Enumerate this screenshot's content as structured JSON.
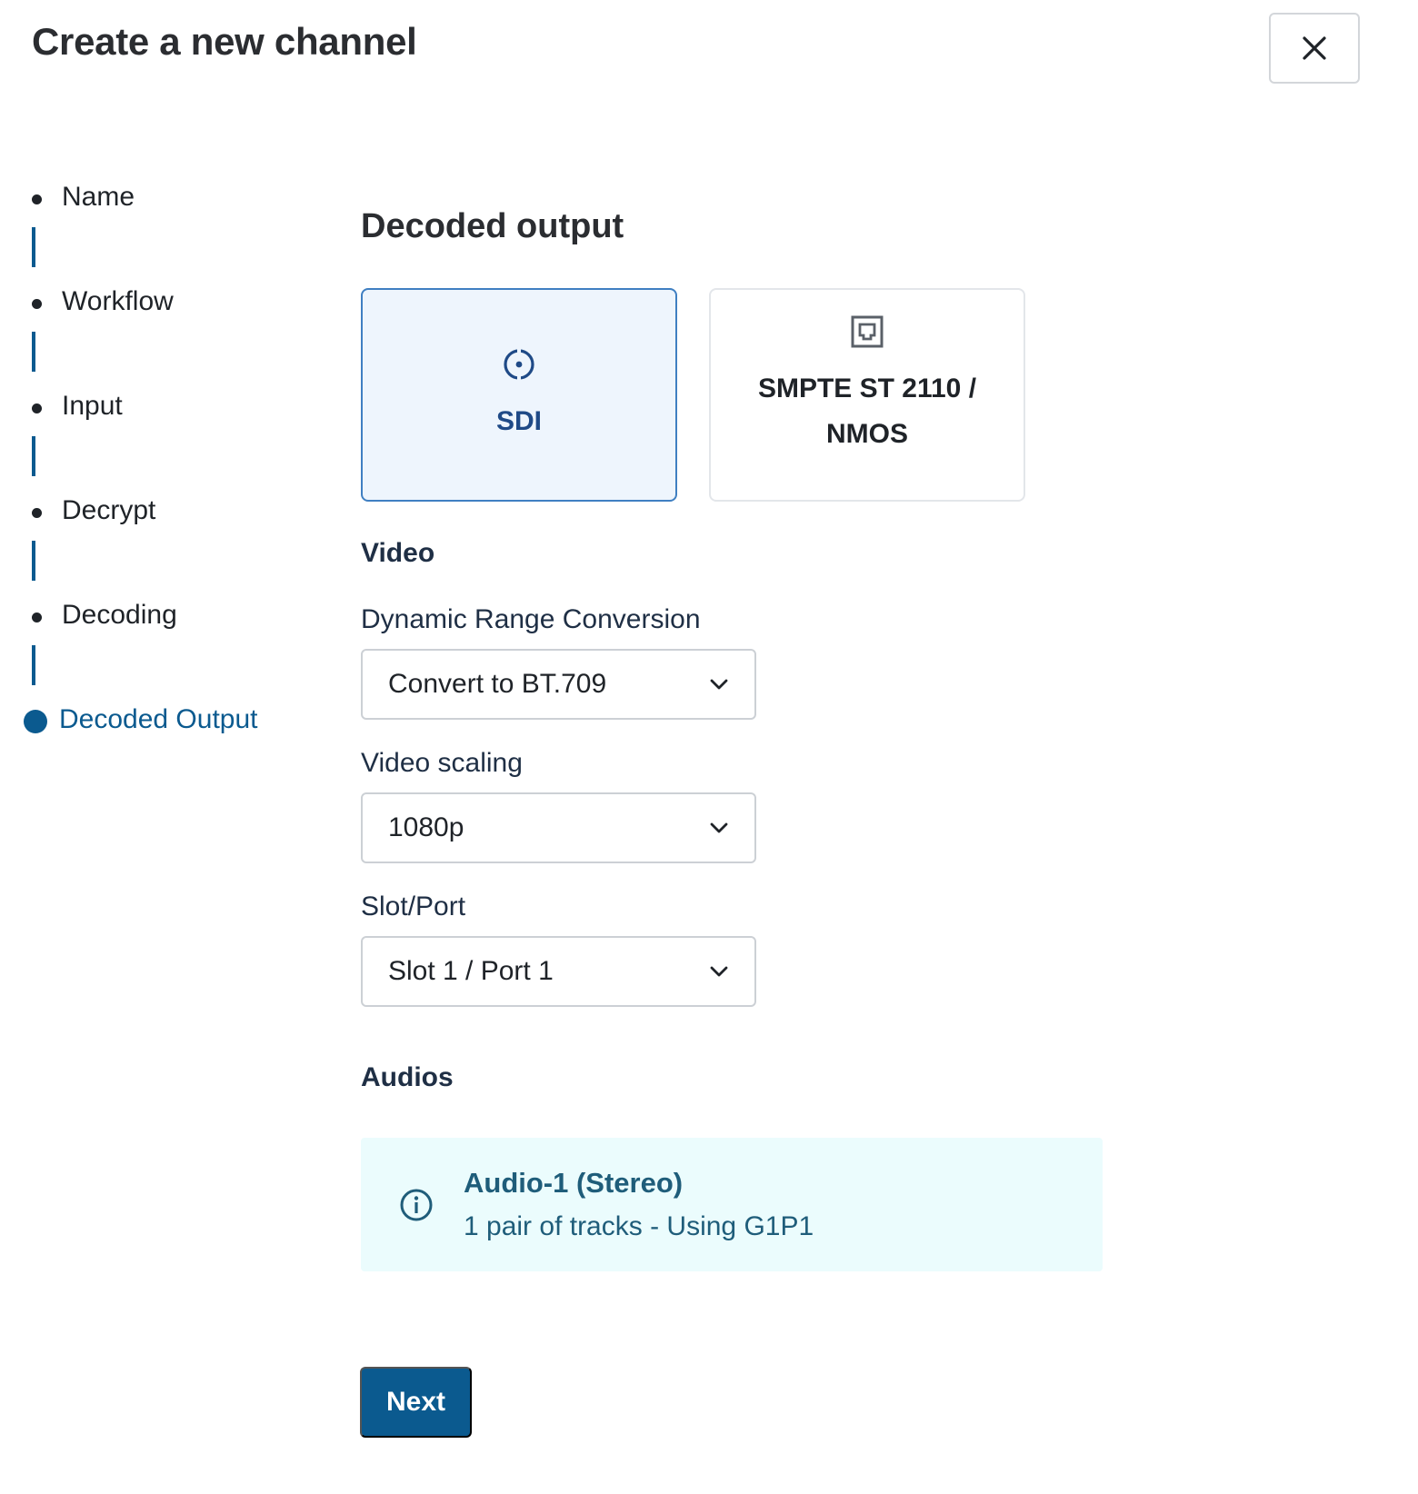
{
  "dialog": {
    "title": "Create a new channel",
    "close_icon": "close-icon"
  },
  "stepper": {
    "steps": [
      {
        "label": "Name",
        "state": "completed"
      },
      {
        "label": "Workflow",
        "state": "completed"
      },
      {
        "label": "Input",
        "state": "completed"
      },
      {
        "label": "Decrypt",
        "state": "completed"
      },
      {
        "label": "Decoding",
        "state": "completed"
      },
      {
        "label": "Decoded Output",
        "state": "active"
      }
    ]
  },
  "main": {
    "section_title": "Decoded output",
    "output_types": [
      {
        "label": "SDI",
        "icon": "sdi-connector-icon",
        "selected": true
      },
      {
        "label_line1": "SMPTE ST 2110 /",
        "label_line2": "NMOS",
        "icon": "ethernet-port-icon",
        "selected": false
      }
    ],
    "video": {
      "heading": "Video",
      "dynamic_range": {
        "label": "Dynamic Range Conversion",
        "value": "Convert to BT.709"
      },
      "scaling": {
        "label": "Video scaling",
        "value": "1080p"
      },
      "slot_port": {
        "label": "Slot/Port",
        "value": "Slot 1 / Port 1"
      }
    },
    "audios": {
      "heading": "Audios",
      "items": [
        {
          "title": "Audio-1 (Stereo)",
          "description": "1 pair of tracks - Using G1P1",
          "icon": "info-icon"
        }
      ]
    },
    "next_label": "Next"
  },
  "colors": {
    "accent": "#0b5a8f",
    "selected_card_bg": "#eef5fd",
    "selected_card_border": "#3f7fc2",
    "info_bg": "#ebfcfd",
    "info_text": "#1f5d7a"
  }
}
